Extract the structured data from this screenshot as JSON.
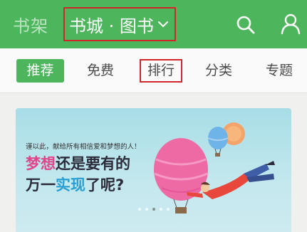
{
  "header": {
    "bookshelf_label": "书架",
    "store_title": "书城 · 图书",
    "store_dropdown_icon": "chevron-down-icon",
    "search_icon": "search-icon",
    "user_icon": "user-icon",
    "bg_color": "#4db55c",
    "highlight_color": "#d2252c"
  },
  "tabs": [
    {
      "label": "推荐",
      "active": true
    },
    {
      "label": "免费",
      "active": false
    },
    {
      "label": "排行",
      "active": false
    },
    {
      "label": "分类",
      "active": false
    },
    {
      "label": "专题",
      "active": false
    }
  ],
  "banner": {
    "dedication": "谨以此，献给所有相信爱和梦想的人！",
    "line1_highlight": "梦想",
    "line1_rest": "还是要有的",
    "line2_a": "万一",
    "line2_highlight": "实现",
    "line2_rest": "了呢?",
    "slide_count": 5,
    "active_slide": 2
  }
}
